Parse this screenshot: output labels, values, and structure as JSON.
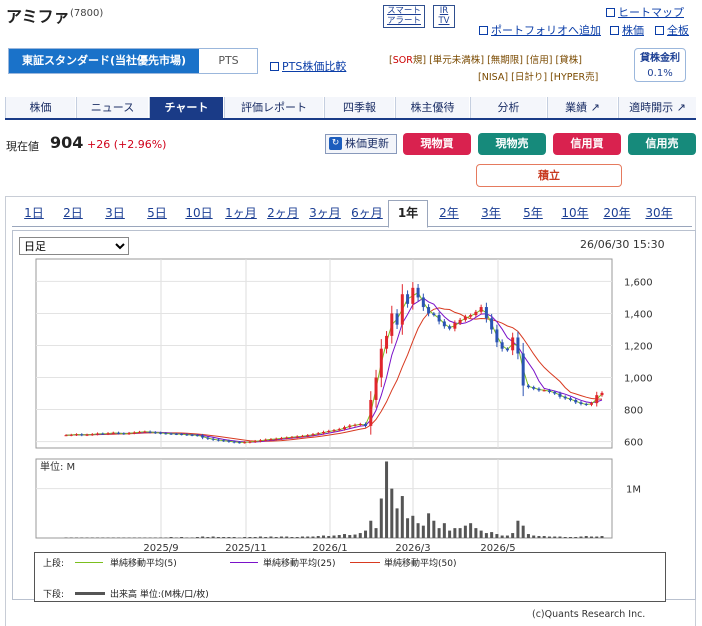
{
  "header": {
    "name": "アミファ",
    "code": "(7800)",
    "smart_alert": "スマート\nアラート",
    "smart_alert_l1": "スマート",
    "smart_alert_l2": "アラート",
    "ir_l1": "IR",
    "ir_l2": "TV",
    "heatmap": "ヒートマップ",
    "portfolio": "ポートフォリオへ追加",
    "kabuka": "株価",
    "zenban": "全板"
  },
  "market": {
    "main": "東証スタンダード(当社優先市場)",
    "pts": "PTS",
    "pts_compare": "PTS株価比較"
  },
  "tags": {
    "row1": [
      "SOR",
      "単元未満株",
      "無期限",
      "信用",
      "貸株"
    ],
    "row1_sor_prefix": "[SOR",
    "row1_sor_suffix": "規]",
    "row2": [
      "NISA",
      "日計り",
      "HYPER売"
    ]
  },
  "lending": {
    "label": "貸株金利",
    "rate": "0.1%"
  },
  "nav": [
    "株価",
    "ニュース",
    "チャート",
    "評価レポート",
    "四季報",
    "株主優待",
    "分析",
    "業績",
    "適時開示"
  ],
  "nav_active": "チャート",
  "price": {
    "label": "現在値",
    "value": "904",
    "change": "+26 (+2.96%)",
    "refresh": "株価更新"
  },
  "trade_buttons": [
    {
      "label": "現物買",
      "color": "#d9224f"
    },
    {
      "label": "現物売",
      "color": "#168a7b"
    },
    {
      "label": "信用買",
      "color": "#d9224f"
    },
    {
      "label": "信用売",
      "color": "#168a7b"
    }
  ],
  "tsumitate": "積立",
  "periods": [
    "1日",
    "2日",
    "3日",
    "5日",
    "10日",
    "1ヶ月",
    "2ヶ月",
    "3ヶ月",
    "6ヶ月",
    "1年",
    "2年",
    "3年",
    "5年",
    "10年",
    "20年",
    "30年"
  ],
  "period_active": "1年",
  "chart": {
    "interval": "日足",
    "timestamp": "26/06/30 15:30",
    "unit_label": "単位: M",
    "legend_upper": "上段:",
    "legend_lower": "下段:",
    "ma5": "単純移動平均(5)",
    "ma25": "単純移動平均(25)",
    "ma50": "単純移動平均(50)",
    "volume_label": "出来高 単位:(M株/口/枚)",
    "copyright": "(c)Quants Research Inc.",
    "colors": {
      "ma5": "#7bbf1e",
      "ma25": "#7a12c9",
      "ma50": "#d83a20",
      "up": "#e0262c",
      "down": "#2b53b3",
      "volume": "#555555"
    }
  },
  "chart_data": {
    "type": "line",
    "price_axis": {
      "ticks": [
        600,
        800,
        1000,
        1200,
        1400,
        1600
      ],
      "ylim": [
        560,
        1740
      ]
    },
    "volume_axis": {
      "ticks": [
        "1M"
      ],
      "ylim": [
        0,
        1.6
      ]
    },
    "x_ticks": [
      "2025/9",
      "2025/11",
      "2026/1",
      "2026/3",
      "2026/5"
    ],
    "close_series": {
      "name": "株価",
      "values": [
        640,
        642,
        645,
        641,
        643,
        646,
        650,
        648,
        652,
        655,
        651,
        649,
        653,
        657,
        660,
        662,
        658,
        655,
        652,
        650,
        648,
        647,
        645,
        642,
        640,
        638,
        625,
        618,
        612,
        608,
        605,
        600,
        596,
        594,
        596,
        599,
        603,
        608,
        612,
        615,
        618,
        622,
        625,
        628,
        632,
        635,
        640,
        646,
        652,
        660,
        666,
        671,
        678,
        690,
        700,
        705,
        710,
        698,
        860,
        1000,
        1180,
        1260,
        1400,
        1330,
        1520,
        1460,
        1560,
        1500,
        1440,
        1400,
        1390,
        1350,
        1320,
        1305,
        1340,
        1360,
        1380,
        1390,
        1410,
        1440,
        1370,
        1300,
        1220,
        1180,
        1170,
        1250,
        1150,
        950,
        940,
        930,
        920,
        920,
        910,
        900,
        880,
        870,
        860,
        845,
        835,
        830,
        840,
        890,
        904
      ]
    },
    "ma5": {
      "name": "単純移動平均(5)"
    },
    "ma25": {
      "name": "単純移動平均(25)"
    },
    "ma50": {
      "name": "単純移動平均(50)"
    },
    "volume": {
      "name": "出来高",
      "values": [
        0.01,
        0.01,
        0.01,
        0.01,
        0.01,
        0.01,
        0.01,
        0.01,
        0.01,
        0.01,
        0.01,
        0.01,
        0.01,
        0.01,
        0.01,
        0.01,
        0.01,
        0.01,
        0.01,
        0.01,
        0.02,
        0.01,
        0.02,
        0.01,
        0.01,
        0.02,
        0.03,
        0.02,
        0.03,
        0.02,
        0.02,
        0.02,
        0.02,
        0.01,
        0.02,
        0.02,
        0.02,
        0.03,
        0.02,
        0.03,
        0.02,
        0.03,
        0.03,
        0.02,
        0.02,
        0.03,
        0.03,
        0.03,
        0.04,
        0.05,
        0.04,
        0.05,
        0.06,
        0.08,
        0.06,
        0.07,
        0.1,
        0.15,
        0.35,
        0.2,
        0.8,
        1.55,
        1.0,
        0.6,
        0.85,
        0.4,
        0.45,
        0.3,
        0.25,
        0.5,
        0.35,
        0.2,
        0.3,
        0.15,
        0.2,
        0.2,
        0.25,
        0.3,
        0.2,
        0.15,
        0.1,
        0.12,
        0.08,
        0.05,
        0.05,
        0.1,
        0.35,
        0.25,
        0.08,
        0.05,
        0.04,
        0.04,
        0.03,
        0.03,
        0.03,
        0.02,
        0.02,
        0.02,
        0.03,
        0.04,
        0.03,
        0.03,
        0.04
      ]
    },
    "title": "",
    "xlabel": "",
    "ylabel": ""
  }
}
